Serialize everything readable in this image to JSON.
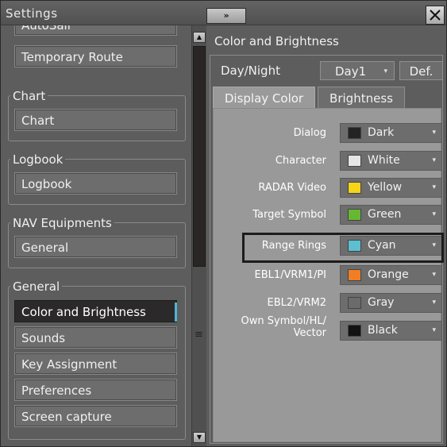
{
  "window": {
    "title": "Settings",
    "pin_glyph": "»",
    "close_icon": "close-icon"
  },
  "left_panel": {
    "partial_item": "AutoSail",
    "temporary_route": "Temporary Route",
    "groups": [
      {
        "label": "Chart",
        "items": [
          "Chart"
        ]
      },
      {
        "label": "Logbook",
        "items": [
          "Logbook"
        ]
      },
      {
        "label": "NAV Equipments",
        "items": [
          "General"
        ]
      },
      {
        "label": "General",
        "items": [
          "Color and Brightness",
          "Sounds",
          "Key Assignment",
          "Preferences",
          "Screen capture"
        ]
      }
    ],
    "selected_item": "Color and Brightness"
  },
  "scrollbar": {
    "grip_glyph": "≡",
    "up_glyph": "▲",
    "down_glyph": "▼"
  },
  "right_panel": {
    "title": "Color and Brightness",
    "daynight_label": "Day/Night",
    "daynight_value": "Day1",
    "def_button": "Def.",
    "tabs": [
      "Display Color",
      "Brightness"
    ],
    "active_tab": "Display Color",
    "rows": [
      {
        "label": "Dialog",
        "value": "Dark",
        "swatch": "#232323"
      },
      {
        "label": "Character",
        "value": "White",
        "swatch": "#e6e6e6"
      },
      {
        "label": "RADAR Video",
        "value": "Yellow",
        "swatch": "#f5d419"
      },
      {
        "label": "Target Symbol",
        "value": "Green",
        "swatch": "#66b833"
      },
      {
        "label": "Range Rings",
        "value": "Cyan",
        "swatch": "#5cc0d0"
      },
      {
        "label": "EBL1/VRM1/PI",
        "value": "Orange",
        "swatch": "#f07e26"
      },
      {
        "label": "EBL2/VRM2",
        "value": "Gray",
        "swatch": "#6b6b6b"
      },
      {
        "label_line1": "Own Symbol/HL/",
        "label_line2": "Vector",
        "value": "Black",
        "swatch": "#121212"
      }
    ],
    "highlighted_row": "Range Rings"
  },
  "colors": {
    "panel_bg": "#5d5d5d",
    "content_bg": "#999999",
    "selected_bg": "#2b2929",
    "accent": "#4fb4d8"
  }
}
